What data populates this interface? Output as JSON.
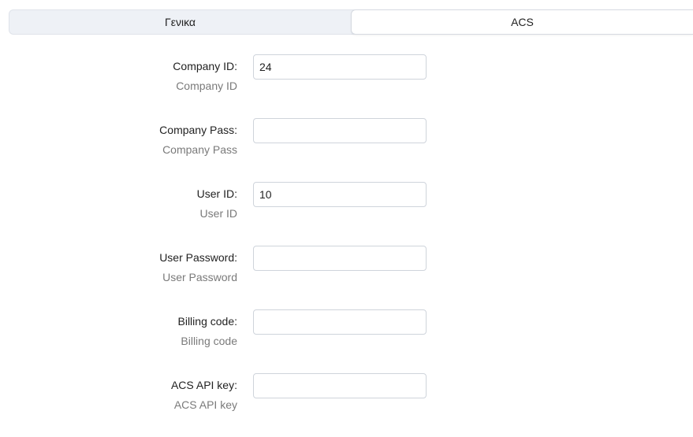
{
  "tabs": [
    {
      "label": "Γενικα",
      "active": false
    },
    {
      "label": "ACS",
      "active": true
    }
  ],
  "fields": [
    {
      "label": "Company ID:",
      "help": "Company ID",
      "value": "24"
    },
    {
      "label": "Company Pass:",
      "help": "Company Pass",
      "value": ""
    },
    {
      "label": "User ID:",
      "help": "User ID",
      "value": "10"
    },
    {
      "label": "User Password:",
      "help": "User Password",
      "value": ""
    },
    {
      "label": "Billing code:",
      "help": "Billing code",
      "value": ""
    },
    {
      "label": "ACS API key:",
      "help": "ACS API key",
      "value": ""
    }
  ]
}
